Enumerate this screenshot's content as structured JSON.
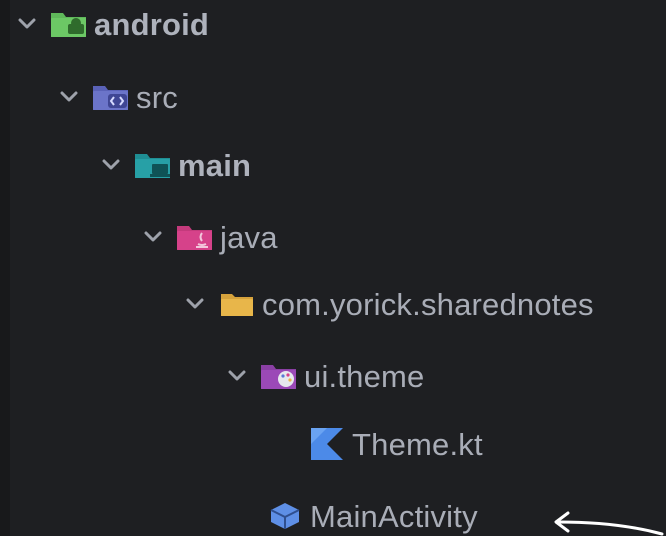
{
  "project_tree": {
    "items": [
      {
        "label": "android",
        "icon": "android-module-folder-icon",
        "expanded": true
      },
      {
        "label": "src",
        "icon": "source-folder-icon",
        "expanded": true
      },
      {
        "label": "main",
        "icon": "main-folder-icon",
        "expanded": true
      },
      {
        "label": "java",
        "icon": "java-folder-icon",
        "expanded": true
      },
      {
        "label": "com.yorick.sharednotes",
        "icon": "package-folder-icon",
        "expanded": true
      },
      {
        "label": "ui.theme",
        "icon": "theme-folder-icon",
        "expanded": true
      },
      {
        "label": "Theme.kt",
        "icon": "kotlin-file-icon"
      },
      {
        "label": "MainActivity",
        "icon": "activity-class-icon"
      }
    ]
  },
  "colors": {
    "background": "#1e1f22",
    "text": "#a9adb7",
    "android_folder": "#5fb85a",
    "src_folder": "#6b74c9",
    "main_folder": "#27a0a6",
    "java_folder": "#d6428a",
    "package_folder": "#e8b64a",
    "theme_folder": "#9b49b7",
    "kotlin": "#4c8ae8",
    "activity": "#5e8fe6",
    "annotation_arrow": "#ffffff"
  }
}
